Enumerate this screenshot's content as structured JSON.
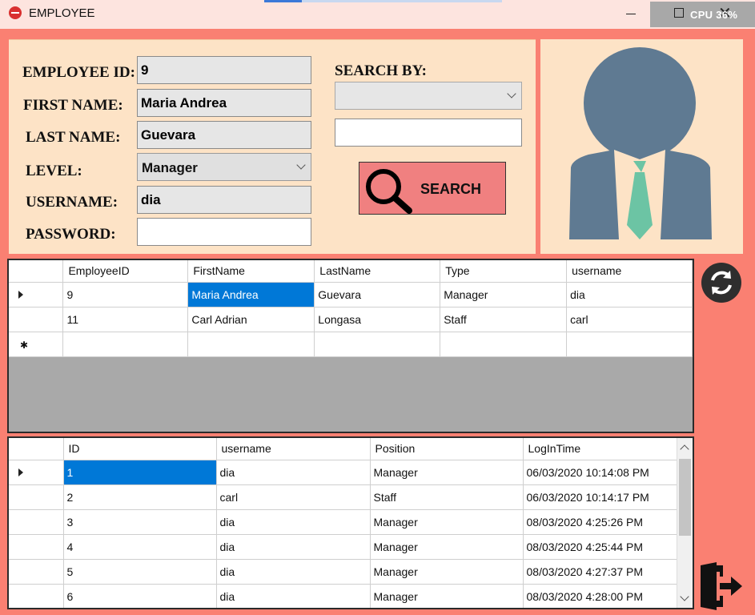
{
  "window": {
    "title": "EMPLOYEE",
    "cpu_label": "CPU",
    "cpu_value": "36%"
  },
  "form": {
    "labels": {
      "employee_id": "EMPLOYEE ID:",
      "first_name": "FIRST NAME:",
      "last_name": "LAST NAME:",
      "level": "LEVEL:",
      "username": "USERNAME:",
      "password": "PASSWORD:"
    },
    "values": {
      "employee_id": "9",
      "first_name": "Maria Andrea",
      "last_name": "Guevara",
      "level": "Manager",
      "username": "dia",
      "password": ""
    }
  },
  "search": {
    "label": "SEARCH BY:",
    "by_value": "",
    "query": "",
    "button_label": "SEARCH"
  },
  "employees_grid": {
    "columns": [
      "EmployeeID",
      "FirstName",
      "LastName",
      "Type",
      "username"
    ],
    "rows": [
      [
        "9",
        "Maria Andrea",
        "Guevara",
        "Manager",
        "dia"
      ],
      [
        "11",
        "Carl Adrian",
        "Longasa",
        "Staff",
        "carl"
      ]
    ]
  },
  "log_grid": {
    "columns": [
      "ID",
      "username",
      "Position",
      "LogInTime"
    ],
    "rows": [
      [
        "1",
        "dia",
        "Manager",
        "06/03/2020 10:14:08 PM"
      ],
      [
        "2",
        "carl",
        "Staff",
        "06/03/2020 10:14:17 PM"
      ],
      [
        "3",
        "dia",
        "Manager",
        "08/03/2020 4:25:26 PM"
      ],
      [
        "4",
        "dia",
        "Manager",
        "08/03/2020 4:25:44 PM"
      ],
      [
        "5",
        "dia",
        "Manager",
        "08/03/2020 4:27:37 PM"
      ],
      [
        "6",
        "dia",
        "Manager",
        "08/03/2020 4:28:00 PM"
      ]
    ]
  },
  "colors": {
    "background": "#fa8072",
    "panel": "#fde3c6",
    "selection": "#0078d7",
    "avatar_body": "#5f7a92",
    "tie": "#6cc4a4"
  },
  "icons": {
    "app": "app-icon",
    "search": "magnifier-icon",
    "refresh": "refresh-icon",
    "exit": "exit-door-icon",
    "avatar": "person-avatar-icon"
  }
}
